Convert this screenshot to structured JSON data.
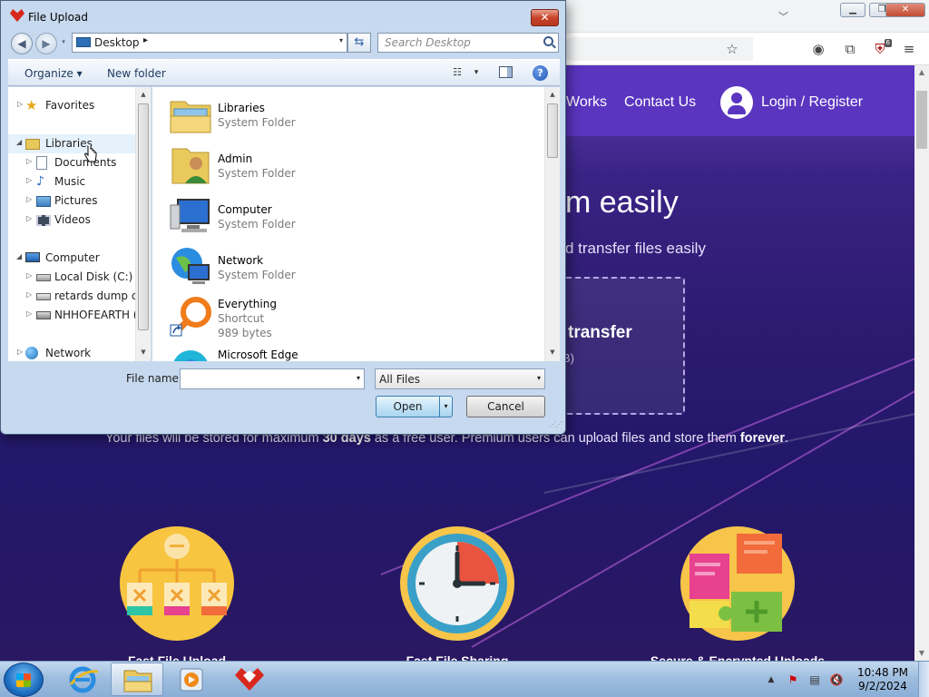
{
  "browser": {
    "extension_badge": "6",
    "nav": {
      "how_it_works": "Works",
      "contact": "Contact Us",
      "login": "Login / Register"
    },
    "hero": {
      "title": "m easily",
      "subtitle": "d transfer files easily"
    },
    "dropzone": {
      "title": "transfer",
      "size": "B)"
    },
    "notice": {
      "part1": "Your files will be stored for maximum ",
      "days": "30 days",
      "part2": " as a free user. Premium users can upload files and store them ",
      "forever": "forever",
      "part3": "."
    },
    "features": [
      "Fast File Upload",
      "Fast File Sharing",
      "Secure & Encrypted Uploads"
    ]
  },
  "dialog": {
    "title": "File Upload",
    "close_label": "✕",
    "address": {
      "location": "Desktop",
      "separator": "▸",
      "dropdown": "▾"
    },
    "search_placeholder": "Search Desktop",
    "toolbar": {
      "organize": "Organize ▾",
      "new_folder": "New folder",
      "views_dropdown": "▾",
      "help": "?"
    },
    "tree": [
      {
        "label": "Favorites",
        "icon": "star-icon",
        "expander": "▷"
      },
      {
        "label": "Libraries",
        "icon": "library-icon",
        "expander": "◢",
        "selected": true
      },
      {
        "label": "Documents",
        "icon": "documents-icon",
        "expander": "▷"
      },
      {
        "label": "Music",
        "icon": "music-icon",
        "expander": "▷"
      },
      {
        "label": "Pictures",
        "icon": "pictures-icon",
        "expander": "▷"
      },
      {
        "label": "Videos",
        "icon": "videos-icon",
        "expander": "▷"
      },
      {
        "label": "Computer",
        "icon": "computer-icon",
        "expander": "◢"
      },
      {
        "label": "Local Disk (C:)",
        "icon": "drive-icon",
        "expander": "▷"
      },
      {
        "label": "retards dump col",
        "icon": "drive-icon",
        "expander": "▷"
      },
      {
        "label": "NHHOFEARTH (F",
        "icon": "network-drive-icon",
        "expander": "▷"
      },
      {
        "label": "Network",
        "icon": "network-icon",
        "expander": "▷"
      }
    ],
    "files": [
      {
        "name": "Libraries",
        "type": "System Folder",
        "icon": "libraries-folder-icon"
      },
      {
        "name": "Admin",
        "type": "System Folder",
        "icon": "user-folder-icon"
      },
      {
        "name": "Computer",
        "type": "System Folder",
        "icon": "computer-icon"
      },
      {
        "name": "Network",
        "type": "System Folder",
        "icon": "network-globe-icon"
      },
      {
        "name": "Everything",
        "type": "Shortcut",
        "size": "989 bytes",
        "icon": "everything-search-icon"
      },
      {
        "name": "Microsoft Edge",
        "type": "",
        "icon": "edge-icon"
      }
    ],
    "file_name_label": "File name:",
    "file_name_value": "",
    "file_type_filter": "All Files",
    "open_button": "Open",
    "cancel_button": "Cancel",
    "split_arrow": "▾",
    "combo_arrow": "▾"
  },
  "taskbar": {
    "clock_time": "10:48 PM",
    "clock_date": "9/2/2024",
    "apps": [
      "ie-icon",
      "explorer-icon",
      "media-player-icon",
      "browser-app-icon"
    ]
  },
  "colors": {
    "page_purple": "#5a35c0",
    "dialog_frame": "#c7d9ef",
    "selection": "#e5f1fb",
    "accent_red": "#d8281d"
  }
}
